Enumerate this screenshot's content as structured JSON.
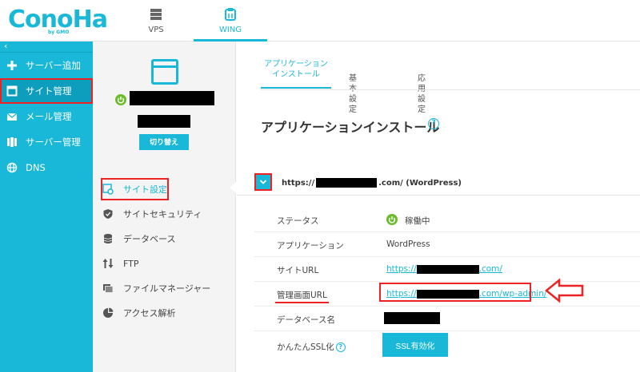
{
  "brand": {
    "logo": "ConoHa",
    "logo_sub": "by GMO"
  },
  "topnav": [
    {
      "label": "VPS",
      "icon": "server-icon"
    },
    {
      "label": "WING",
      "icon": "wing-icon",
      "active": true
    }
  ],
  "sidebar": {
    "items": [
      {
        "label": "サーバー追加",
        "icon": "plus-icon"
      },
      {
        "label": "サイト管理",
        "icon": "window-icon",
        "active": true
      },
      {
        "label": "メール管理",
        "icon": "mail-icon"
      },
      {
        "label": "サーバー管理",
        "icon": "server-stack-icon"
      },
      {
        "label": "DNS",
        "icon": "globe-icon"
      }
    ]
  },
  "site_panel": {
    "switch_label": "切り替え",
    "menu": [
      {
        "label": "サイト設定",
        "icon": "gear-icon",
        "active": true
      },
      {
        "label": "サイトセキュリティ",
        "icon": "shield-icon"
      },
      {
        "label": "データベース",
        "icon": "database-icon"
      },
      {
        "label": "FTP",
        "icon": "updown-arrows-icon"
      },
      {
        "label": "ファイルマネージャー",
        "icon": "folder-icon"
      },
      {
        "label": "アクセス解析",
        "icon": "pie-chart-icon"
      }
    ]
  },
  "tabs": [
    {
      "label_line1": "アプリケーション",
      "label_line2": "インストール",
      "active": true
    },
    {
      "label": "基本設定"
    },
    {
      "label": "応用設定"
    }
  ],
  "section_title": "アプリケーションインストール",
  "app": {
    "url_prefix": "https://",
    "url_suffix": ".com/ (WordPress)"
  },
  "details": {
    "status_label": "ステータス",
    "status_value": "稼働中",
    "application_label": "アプリケーション",
    "application_value": "WordPress",
    "site_url_label": "サイトURL",
    "site_url_prefix": "https://",
    "site_url_suffix": ".com/",
    "admin_url_label": "管理画面URL",
    "admin_url_prefix": "https://",
    "admin_url_suffix": ".com/wp-admin/",
    "db_name_label": "データベース名",
    "ssl_label": "かんたんSSL化",
    "ssl_button": "SSL有効化"
  },
  "colors": {
    "accent": "#19b8d8",
    "highlight": "#e22222",
    "status_green": "#6cbb2b"
  }
}
